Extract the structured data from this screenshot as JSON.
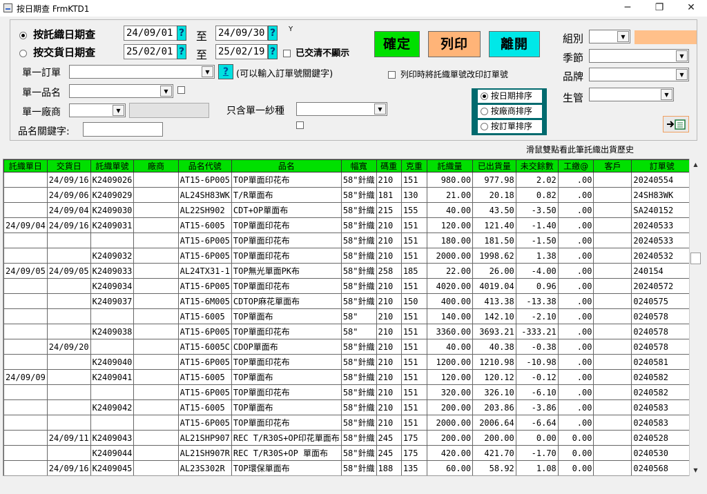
{
  "window": {
    "title": "按日期查 FrmKTD1",
    "min": "─",
    "max": "❐",
    "close": "✕"
  },
  "filters": {
    "radio_weave": "按託織日期查",
    "radio_ship": "按交貨日期查",
    "weave_from": "24/09/01",
    "weave_to": "24/09/30",
    "ship_from": "25/02/01",
    "ship_to": "25/02/19",
    "q": "?",
    "to": "至",
    "y_mark": "Y",
    "cleared_label": "已交清不顯示",
    "single_order_label": "單一訂單",
    "order_hint": "(可以輸入訂單號關鍵字)",
    "single_item_label": "單一品名",
    "single_vendor_label": "單一廠商",
    "only_yarn_label": "只含單一紗種",
    "keyword_label": "品名關鍵字:"
  },
  "buttons": {
    "ok": "確定",
    "print": "列印",
    "exit": "離開"
  },
  "print_option": "列印時將託織單號改印訂單號",
  "sort": {
    "date": "按日期排序",
    "vendor": "按廠商排序",
    "order": "按訂單排序"
  },
  "right": {
    "group": "組別",
    "season": "季節",
    "brand": "品牌",
    "manager": "生管"
  },
  "hint": "滑鼠雙點看此筆託織出貨歷史",
  "colors": {
    "header": "#00e000",
    "ok": "#00e000",
    "print": "#ffb478",
    "exit": "#00e8e8"
  },
  "grid": {
    "headers": [
      "託織單日",
      "交貨日",
      "託織單號",
      "廠商",
      "品名代號",
      "品名",
      "幅寬",
      "碼重",
      "克重",
      "託織量",
      "已出貨量",
      "未交餘數",
      "工繳@",
      "客戶",
      "訂單號"
    ],
    "rows": [
      [
        "",
        "24/09/16",
        "K2409026",
        "",
        "AT15-6P005",
        "TOP單面印花布",
        "58\"針織",
        "210",
        "151",
        "980.00",
        "977.98",
        "2.02",
        ".00",
        "",
        "20240554"
      ],
      [
        "",
        "24/09/06",
        "K2409029",
        "",
        "AL24SH83WK",
        "T/R單面布",
        "58\"針織",
        "181",
        "130",
        "21.00",
        "20.18",
        "0.82",
        ".00",
        "",
        "24SH83WK"
      ],
      [
        "",
        "24/09/04",
        "K2409030",
        "",
        "AL22SH902",
        "CDT+OP單面布",
        "58\"針織",
        "215",
        "155",
        "40.00",
        "43.50",
        "-3.50",
        ".00",
        "",
        "SA240152"
      ],
      [
        "24/09/04",
        "24/09/16",
        "K2409031",
        "",
        "AT15-6005",
        "TOP單面印花布",
        "58\"針織",
        "210",
        "151",
        "120.00",
        "121.40",
        "-1.40",
        ".00",
        "",
        "20240533"
      ],
      [
        "",
        "",
        "",
        "",
        "AT15-6P005",
        "TOP單面印花布",
        "58\"針織",
        "210",
        "151",
        "180.00",
        "181.50",
        "-1.50",
        ".00",
        "",
        "20240533"
      ],
      [
        "",
        "",
        "K2409032",
        "",
        "AT15-6P005",
        "TOP單面印花布",
        "58\"針織",
        "210",
        "151",
        "2000.00",
        "1998.62",
        "1.38",
        ".00",
        "",
        "20240532"
      ],
      [
        "24/09/05",
        "24/09/05",
        "K2409033",
        "",
        "AL24TX31-1",
        "TOP無光單面PK布",
        "58\"針織",
        "258",
        "185",
        "22.00",
        "26.00",
        "-4.00",
        ".00",
        "",
        "240154"
      ],
      [
        "",
        "",
        "K2409034",
        "",
        "AT15-6P005",
        "TOP單面印花布",
        "58\"針織",
        "210",
        "151",
        "4020.00",
        "4019.04",
        "0.96",
        ".00",
        "",
        "20240572"
      ],
      [
        "",
        "",
        "K2409037",
        "",
        "AT15-6M005",
        "CDTOP麻花單面布",
        "58\"針織",
        "210",
        "150",
        "400.00",
        "413.38",
        "-13.38",
        ".00",
        "",
        "0240575"
      ],
      [
        "",
        "",
        "",
        "",
        "AT15-6005",
        "TOP單面布",
        "58\"",
        "210",
        "151",
        "140.00",
        "142.10",
        "-2.10",
        ".00",
        "",
        "0240578"
      ],
      [
        "",
        "",
        "K2409038",
        "",
        "AT15-6P005",
        "TOP單面印花布",
        "58\"",
        "210",
        "151",
        "3360.00",
        "3693.21",
        "-333.21",
        ".00",
        "",
        "0240578"
      ],
      [
        "",
        "24/09/20",
        "",
        "",
        "AT15-6005C",
        "CDOP單面布",
        "58\"針織",
        "210",
        "151",
        "40.00",
        "40.38",
        "-0.38",
        ".00",
        "",
        "0240578"
      ],
      [
        "",
        "",
        "K2409040",
        "",
        "AT15-6P005",
        "TOP單面印花布",
        "58\"針織",
        "210",
        "151",
        "1200.00",
        "1210.98",
        "-10.98",
        ".00",
        "",
        "0240581"
      ],
      [
        "24/09/09",
        "",
        "K2409041",
        "",
        "AT15-6005",
        "TOP單面布",
        "58\"針織",
        "210",
        "151",
        "120.00",
        "120.12",
        "-0.12",
        ".00",
        "",
        "0240582"
      ],
      [
        "",
        "",
        "",
        "",
        "AT15-6P005",
        "TOP單面印花布",
        "58\"針織",
        "210",
        "151",
        "320.00",
        "326.10",
        "-6.10",
        ".00",
        "",
        "0240582"
      ],
      [
        "",
        "",
        "K2409042",
        "",
        "AT15-6005",
        "TOP單面布",
        "58\"針織",
        "210",
        "151",
        "200.00",
        "203.86",
        "-3.86",
        ".00",
        "",
        "0240583"
      ],
      [
        "",
        "",
        "",
        "",
        "AT15-6P005",
        "TOP單面印花布",
        "58\"針織",
        "210",
        "151",
        "2000.00",
        "2006.64",
        "-6.64",
        ".00",
        "",
        "0240583"
      ],
      [
        "",
        "24/09/11",
        "K2409043",
        "",
        "AL21SHP907",
        "REC T/R30S+OP印花單面布",
        "58\"針織",
        "245",
        "175",
        "200.00",
        "200.00",
        "0.00",
        "0.00",
        "",
        "0240528"
      ],
      [
        "",
        "",
        "K2409044",
        "",
        "AL21SH907R",
        "REC T/R30S+OP 單面布",
        "58\"針織",
        "245",
        "175",
        "420.00",
        "421.70",
        "-1.70",
        "0.00",
        "",
        "0240530"
      ],
      [
        "",
        "24/09/16",
        "K2409045",
        "",
        "AL23S302R",
        "TOP環保單面布",
        "58\"針織",
        "188",
        "135",
        "60.00",
        "58.92",
        "1.08",
        "0.00",
        "",
        "0240568"
      ]
    ]
  }
}
